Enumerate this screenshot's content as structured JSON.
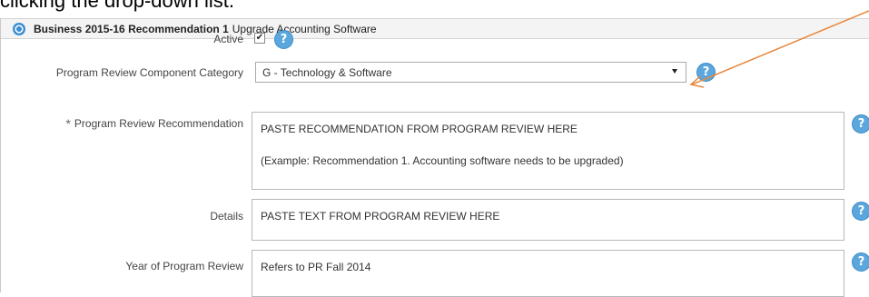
{
  "caption": "clicking the drop-down list.",
  "panel": {
    "title_bold": "Business 2015-16 Recommendation 1",
    "title_rest": "Upgrade Accounting Software"
  },
  "form": {
    "active": {
      "label": "Active",
      "checked": true,
      "check_glyph": "✔"
    },
    "category": {
      "label": "Program Review Component Category",
      "value": "G - Technology & Software"
    },
    "recommendation": {
      "required_mark": "*",
      "label": "Program Review Recommendation",
      "line1": "PASTE RECOMMENDATION FROM PROGRAM REVIEW HERE",
      "line2": "(Example: Recommendation 1. Accounting software needs to be upgraded)"
    },
    "details": {
      "label": "Details",
      "value": "PASTE TEXT FROM PROGRAM REVIEW HERE"
    },
    "year": {
      "label": "Year of Program Review",
      "value": "Refers to PR Fall 2014"
    }
  },
  "help_glyph": "?",
  "colors": {
    "help_blue": "#5ba7dd",
    "annotation_arrow": "#e8863a",
    "header_icon": "#3b8ed1"
  }
}
